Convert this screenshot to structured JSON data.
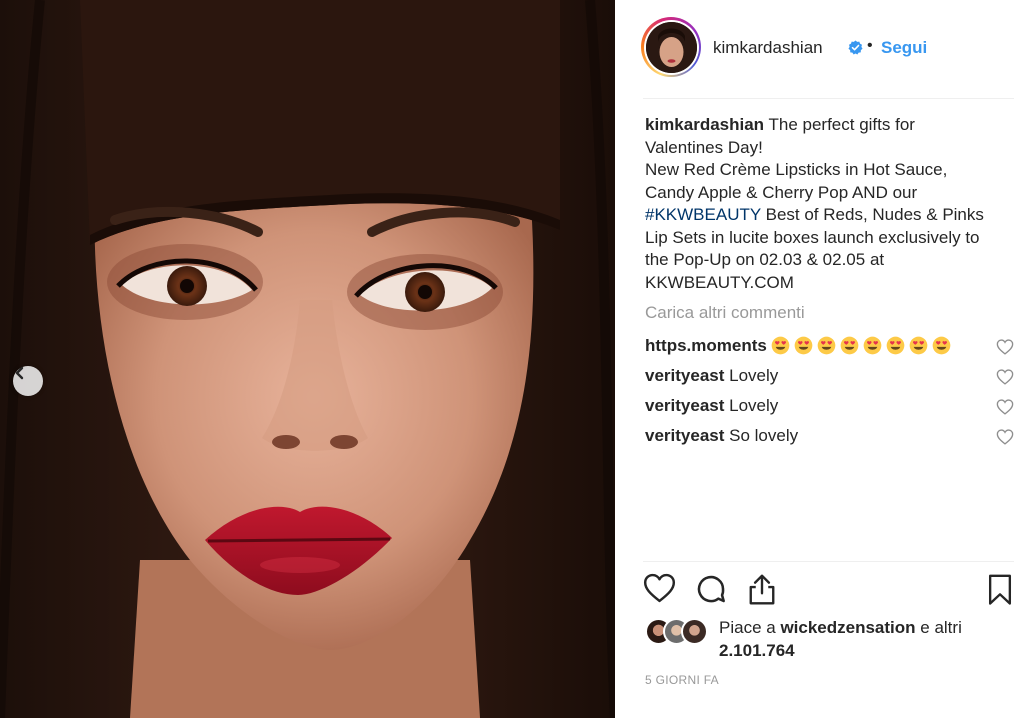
{
  "post": {
    "username": "kimkardashian",
    "follow_label": "Segui",
    "separator": "•",
    "caption": {
      "author": "kimkardashian",
      "text_part1": " The perfect gifts for Valentines Day!\nNew Red Crème Lipsticks in Hot Sauce, Candy Apple & Cherry Pop AND our ",
      "hashtag": "#KKWBEAUTY",
      "text_part2": " Best of Reds, Nudes & Pinks Lip Sets in lucite boxes launch exclusively to the Pop-Up on 02.03 & 02.05 at KKWBEAUTY.COM"
    },
    "load_more_label": "Carica altri commenti",
    "comments": [
      {
        "user": "https.moments",
        "text": "",
        "emoji_count": 8,
        "emoji": "heart-eyes"
      },
      {
        "user": "verityeast",
        "text": " Lovely"
      },
      {
        "user": "verityeast",
        "text": " Lovely"
      },
      {
        "user": "verityeast",
        "text": " So lovely"
      }
    ],
    "likes": {
      "prefix": "Piace a ",
      "user": "wickedzensation",
      "middle": " e altri ",
      "count": "2.101.764"
    },
    "timestamp": "5 GIORNI FA"
  },
  "icons": {
    "verified": "verified-badge-icon",
    "prev": "chevron-left-icon",
    "like": "heart-icon",
    "comment": "comment-bubble-icon",
    "share": "share-icon",
    "save": "bookmark-icon"
  },
  "colors": {
    "link_blue": "#3897f0",
    "hashtag": "#003569",
    "muted": "#999999",
    "text": "#262626",
    "photo_background": "#3e9aa5"
  }
}
